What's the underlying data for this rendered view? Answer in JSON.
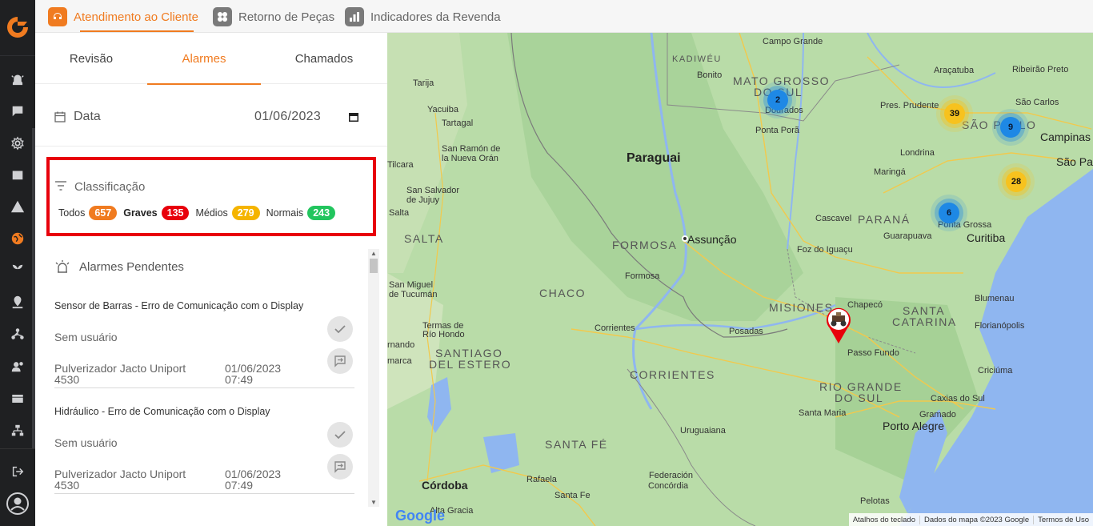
{
  "top_tabs": [
    {
      "label": "Atendimento ao Cliente",
      "icon": "headset-icon",
      "color": "#f07b20",
      "active": true
    },
    {
      "label": "Retorno de Peças",
      "icon": "parts-icon",
      "color": "#7a7a7a"
    },
    {
      "label": "Indicadores da Revenda",
      "icon": "chart-icon",
      "color": "#7a7a7a"
    }
  ],
  "panel": {
    "tabs": [
      "Revisão",
      "Alarmes",
      "Chamados"
    ],
    "active_tab": "Alarmes",
    "date_label": "Data",
    "date_value": "01/06/2023",
    "classification": {
      "title": "Classificação",
      "items": [
        {
          "label": "Todos",
          "count": "657",
          "color": "#f07b20"
        },
        {
          "label": "Graves",
          "count": "135",
          "color": "#e8000b"
        },
        {
          "label": "Médios",
          "count": "279",
          "color": "#f5b400"
        },
        {
          "label": "Normais",
          "count": "243",
          "color": "#22c55e"
        }
      ]
    },
    "pending_title": "Alarmes Pendentes",
    "alarms": [
      {
        "name": "Sensor de Barras - Erro de Comunicação com o Display",
        "user": "Sem usuário",
        "equipment": "Pulverizador Jacto Uniport 4530",
        "date": "01/06/2023",
        "time": "07:49"
      },
      {
        "name": "Hidráulico - Erro de Comunicação com o Display",
        "user": "Sem usuário",
        "equipment": "Pulverizador Jacto Uniport 4530",
        "date": "01/06/2023",
        "time": "07:49"
      }
    ]
  },
  "map": {
    "labels": {
      "campo_grande": "Campo Grande",
      "kadiweu": "KADIWÉU",
      "bonito": "Bonito",
      "mato_grosso": "MATO GROSSO",
      "do_sul": "DO SUL",
      "dourados": "Dourados",
      "ponta_pora": "Ponta Porã",
      "aracatuba": "Araçatuba",
      "ribeirao": "Ribeirão Preto",
      "pres_prudente": "Pres. Prudente",
      "sao_carlos": "São Carlos",
      "sao_paulo_st": "SÃO PAULO",
      "campinas": "Campinas",
      "sao_pa": "São Pa",
      "londrina": "Londrina",
      "maringa": "Maringá",
      "tarija": "Tarija",
      "yacuiba": "Yacuiba",
      "tartagal": "Tartagal",
      "san_ramon": "San Ramón de",
      "nueva_oran": "la Nueva Orán",
      "tilcara": "Tilcara",
      "san_salvador": "San Salvador",
      "de_jujuy": "de Jujuy",
      "salta_city": "Salta",
      "salta_prov": "SALTA",
      "paraguai": "Paraguai",
      "formosa_prov": "FORMOSA",
      "assuncao": "Assunção",
      "formosa_city": "Formosa",
      "chaco": "CHACO",
      "cascavel": "Cascavel",
      "parana": "PARANÁ",
      "guarapuava": "Guarapuava",
      "ponta_grossa": "Ponta Grossa",
      "curitiba": "Curitiba",
      "foz": "Foz do Iguaçu",
      "san_miguel": "San Miguel",
      "de_tucuman": "de Tucumán",
      "termas1": "Termas de",
      "termas2": "Río Hondo",
      "rnando": "rnando",
      "marca": "marca",
      "santiago1": "SANTIAGO",
      "santiago2": "DEL ESTERO",
      "corrientes_city": "Corrientes",
      "corrientes_prov": "CORRIENTES",
      "posadas": "Posadas",
      "misiones": "MISIONES",
      "chapeco": "Chapecó",
      "santa1": "SANTA",
      "santa2": "CATARINA",
      "blumenau": "Blumenau",
      "florianopolis": "Florianópolis",
      "passo_fundo": "Passo Fundo",
      "rio_grande1": "RIO GRANDE",
      "rio_grande2": "DO SUL",
      "caxias": "Caxias do Sul",
      "criciuma": "Criciúma",
      "gramado": "Gramado",
      "santa_maria": "Santa Maria",
      "porto_alegre": "Porto Alegre",
      "uruguaiana": "Uruguaiana",
      "santa_fe": "SANTA FÉ",
      "cordoba": "Córdoba",
      "rafaela": "Rafaela",
      "federacion": "Federación",
      "concordia": "Concórdia",
      "santa_fe_city": "Santa Fe",
      "alta_gracia": "Alta Gracia",
      "pelotas": "Pelotas"
    },
    "clusters": [
      {
        "count": "2",
        "color": "blue"
      },
      {
        "count": "39",
        "color": "yellow"
      },
      {
        "count": "9",
        "color": "blue"
      },
      {
        "count": "28",
        "color": "yellow"
      },
      {
        "count": "6",
        "color": "blue"
      }
    ],
    "google": "Google",
    "attribution": [
      "Atalhos do teclado",
      "Dados do mapa ©2023 Google",
      "Termos de Uso"
    ]
  }
}
